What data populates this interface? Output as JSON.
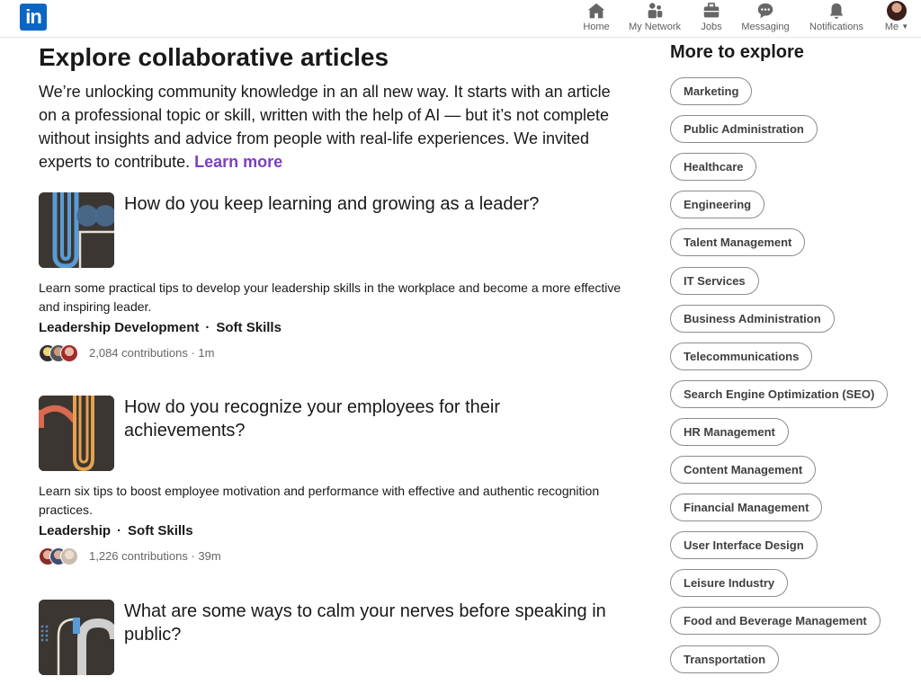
{
  "nav": {
    "logo_text": "in",
    "items": [
      {
        "label": "Home",
        "icon": "home-icon"
      },
      {
        "label": "My Network",
        "icon": "network-icon"
      },
      {
        "label": "Jobs",
        "icon": "briefcase-icon"
      },
      {
        "label": "Messaging",
        "icon": "messaging-icon"
      },
      {
        "label": "Notifications",
        "icon": "bell-icon"
      },
      {
        "label": "Me",
        "icon": "avatar"
      }
    ]
  },
  "main": {
    "title": "Explore collaborative articles",
    "intro": "We’re unlocking community knowledge in an all new way. It starts with an article on a professional topic or skill, written with the help of AI — but it’s not complete without insights and advice from people with real-life experiences. We invited experts to contribute.",
    "learn_more": "Learn more",
    "articles": [
      {
        "title": "How do you keep learning and growing as a leader?",
        "description": "Learn some practical tips to develop your leadership skills in the workplace and become a more effective and inspiring leader.",
        "tags": [
          "Leadership Development",
          "Soft Skills"
        ],
        "tag_separator": "·",
        "contributions": "2,084 contributions · 1m"
      },
      {
        "title": "How do you recognize your employees for their achievements?",
        "description": "Learn six tips to boost employee motivation and performance with effective and authentic recognition practices.",
        "tags": [
          "Leadership",
          "Soft Skills"
        ],
        "tag_separator": "·",
        "contributions": "1,226 contributions · 39m"
      },
      {
        "title": "What are some ways to calm your nerves before speaking in public?",
        "description": "",
        "tags": [],
        "tag_separator": "",
        "contributions": ""
      }
    ]
  },
  "sidebar": {
    "title": "More to explore",
    "topics": [
      "Marketing",
      "Public Administration",
      "Healthcare",
      "Engineering",
      "Talent Management",
      "IT Services",
      "Business Administration",
      "Telecommunications",
      "Search Engine Optimization (SEO)",
      "HR Management",
      "Content Management",
      "Financial Management",
      "User Interface Design",
      "Leisure Industry",
      "Food and Beverage Management",
      "Transportation"
    ]
  },
  "colors": {
    "brand": "#0a66c2",
    "learn_more": "#7c3fc1",
    "thumb_bg": "#3b3632",
    "accent_blue": "#5b9bd5",
    "accent_orange": "#e5a24e",
    "accent_red": "#d9694f"
  }
}
